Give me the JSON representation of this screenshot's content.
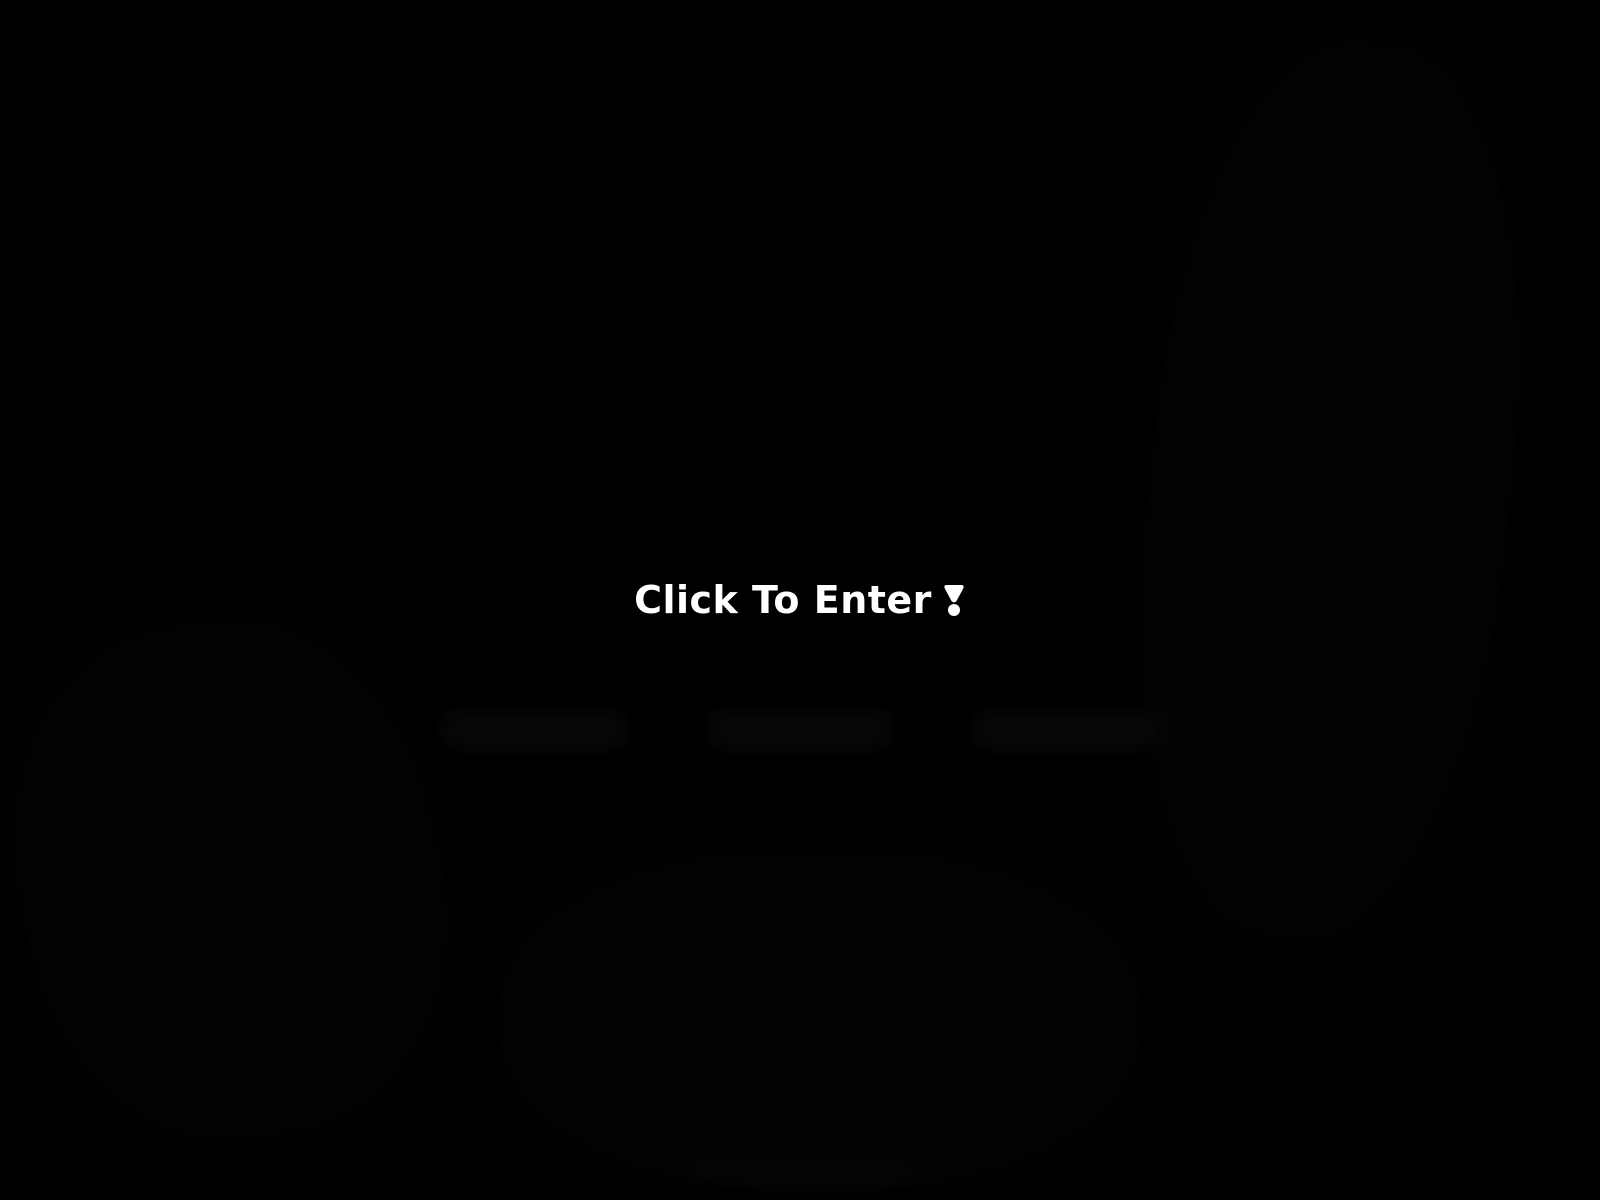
{
  "background": {
    "color": "#000000",
    "blurred_content": true
  },
  "overlay": {
    "enter_label": "Click To Enter",
    "enter_icon": "exclamation-icon",
    "text_color": "#ffffff"
  }
}
